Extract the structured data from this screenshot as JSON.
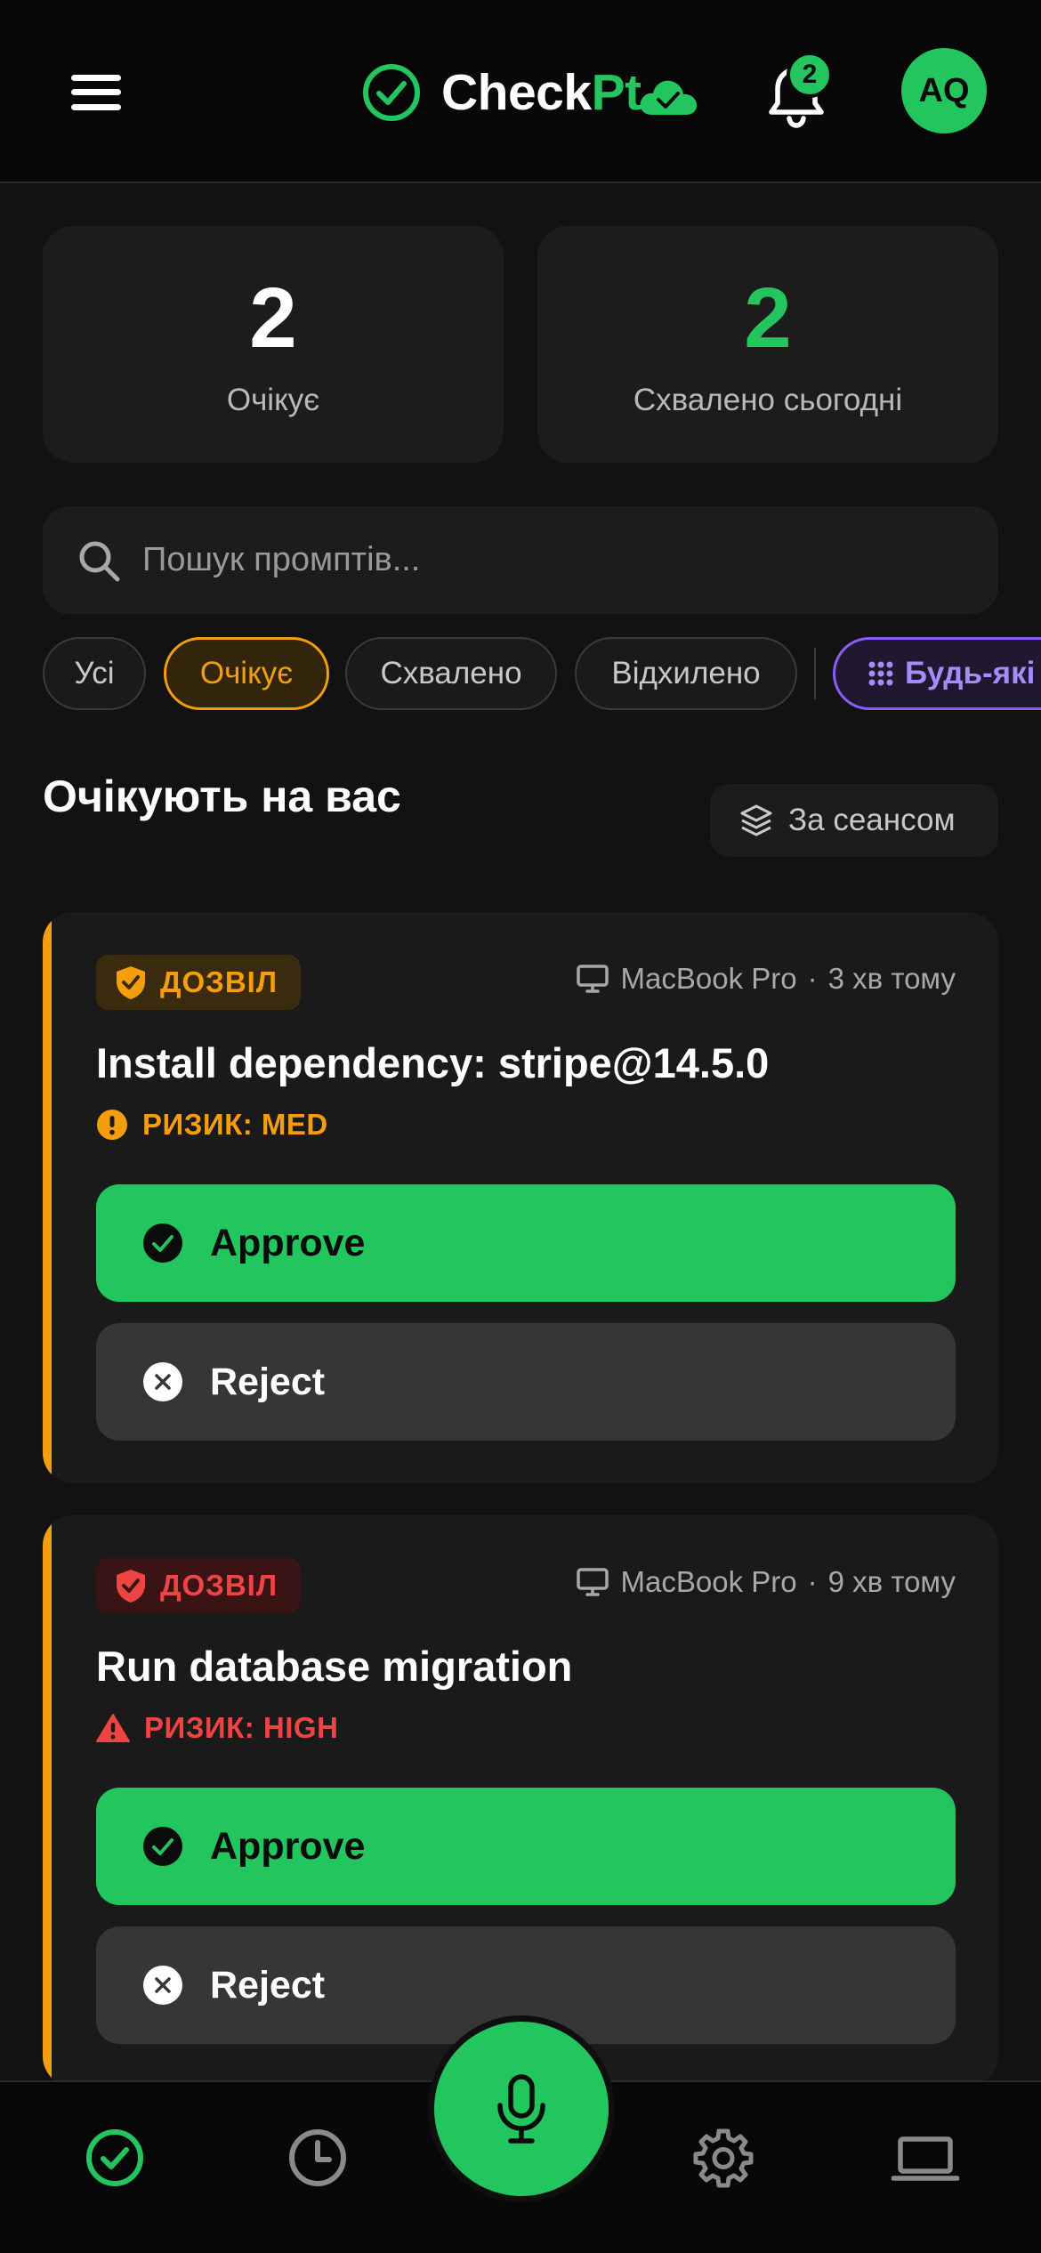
{
  "header": {
    "menu_icon": "hamburger-menu-icon",
    "logo": {
      "text_a": "Check",
      "text_b": "Pt",
      "icon": "check-circle-icon",
      "cloud_icon": "cloud-check-icon"
    },
    "notifications": {
      "icon": "bell-icon",
      "count": "2"
    },
    "avatar": {
      "initials": "AQ"
    }
  },
  "stats": [
    {
      "value": "2",
      "label": "Очікує"
    },
    {
      "value": "2",
      "label": "Схвалено сьогодні"
    }
  ],
  "search": {
    "placeholder": "Пошук промптів...",
    "value": "",
    "icon": "search-icon"
  },
  "filters": {
    "items": [
      {
        "label": "Усі",
        "active": false
      },
      {
        "label": "Очікує",
        "active": true
      },
      {
        "label": "Схвалено",
        "active": false
      },
      {
        "label": "Відхилено",
        "active": false
      }
    ],
    "any_label": "Будь-які"
  },
  "section": {
    "title": "Очікують на вас",
    "group_label": "За сеансом",
    "group_icon": "layers-icon"
  },
  "requests": [
    {
      "badge": "ДОЗВІЛ",
      "device": "MacBook Pro",
      "time": "3 хв тому",
      "title": "Install dependency: stripe@14.5.0",
      "risk": "РИЗИК: MED",
      "approve_label": "Approve",
      "reject_label": "Reject"
    },
    {
      "badge": "ДОЗВІЛ",
      "device": "MacBook Pro",
      "time": "9 хв тому",
      "title": "Run database migration",
      "risk": "РИЗИК: HIGH",
      "approve_label": "Approve",
      "reject_label": "Reject"
    }
  ],
  "colors": {
    "accent": "#22c55e",
    "pending": "#f59e0b",
    "danger": "#ef4444",
    "purple": "#8b5cf6"
  },
  "bottom_nav": {
    "items": [
      "check-circle-icon",
      "clock-icon",
      "microphone-icon",
      "gear-icon",
      "laptop-icon"
    ]
  }
}
